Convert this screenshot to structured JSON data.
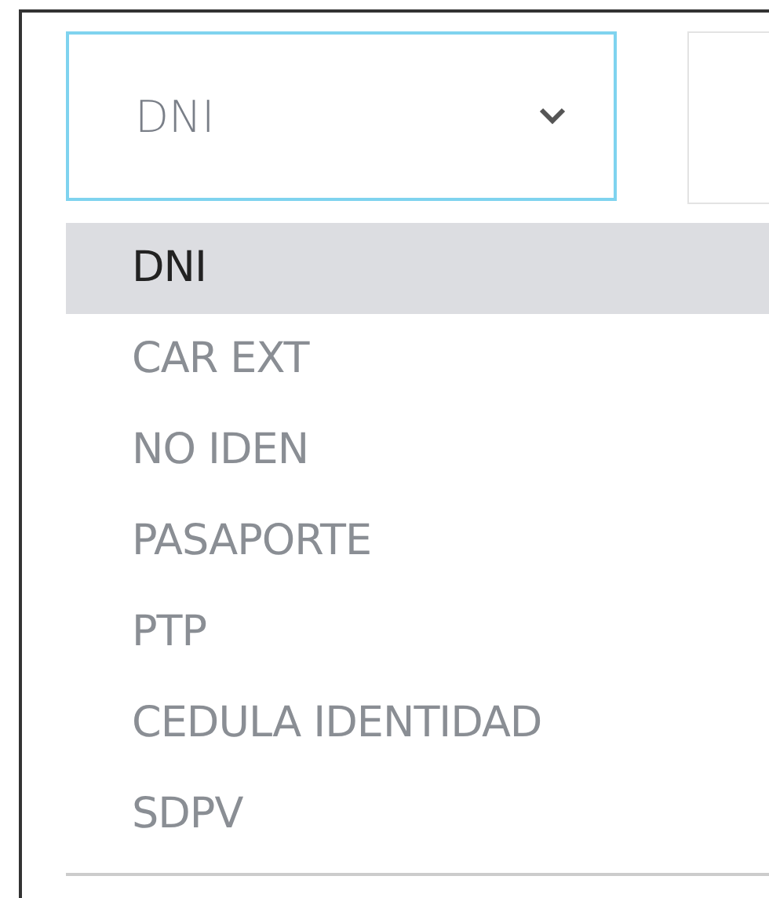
{
  "select": {
    "value": "DNI",
    "expanded": true
  },
  "options": [
    {
      "label": "DNI",
      "selected": true
    },
    {
      "label": "CAR EXT",
      "selected": false
    },
    {
      "label": "NO IDEN",
      "selected": false
    },
    {
      "label": "PASAPORTE",
      "selected": false
    },
    {
      "label": "PTP",
      "selected": false
    },
    {
      "label": "CEDULA IDENTIDAD",
      "selected": false
    },
    {
      "label": "SDPV",
      "selected": false
    }
  ]
}
